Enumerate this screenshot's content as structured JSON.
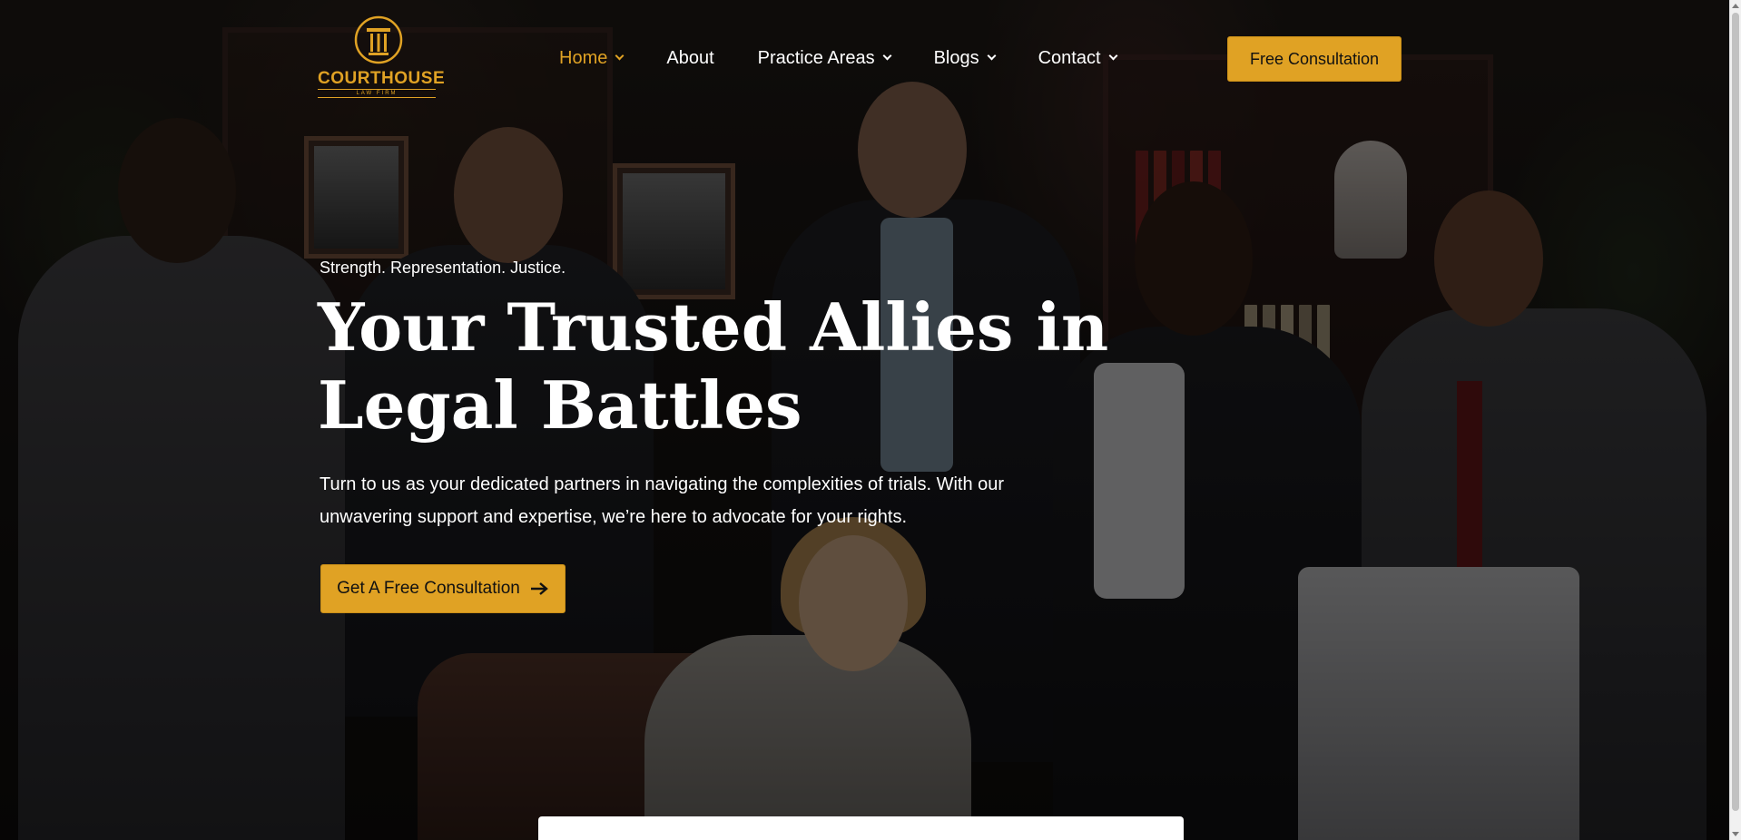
{
  "brand": {
    "name": "COURTHOUSE",
    "subtitle": "LAW FIRM",
    "accent_color": "#e0a224",
    "logo_icon": "pillar-icon"
  },
  "nav": {
    "items": [
      {
        "label": "Home",
        "has_dropdown": true,
        "active": true
      },
      {
        "label": "About",
        "has_dropdown": false,
        "active": false
      },
      {
        "label": "Practice Areas",
        "has_dropdown": true,
        "active": false
      },
      {
        "label": "Blogs",
        "has_dropdown": true,
        "active": false
      },
      {
        "label": "Contact",
        "has_dropdown": true,
        "active": false
      }
    ],
    "cta_label": "Free Consultation"
  },
  "hero": {
    "tagline": "Strength. Representation. Justice.",
    "headline": "Your Trusted Allies in Legal Battles",
    "description": "Turn to us as your dedicated partners in navigating the complexities of trials. With our unwavering support and expertise, we’re here to advocate for your rights.",
    "cta_label": "Get A Free Consultation",
    "cta_icon": "arrow-right-icon"
  }
}
